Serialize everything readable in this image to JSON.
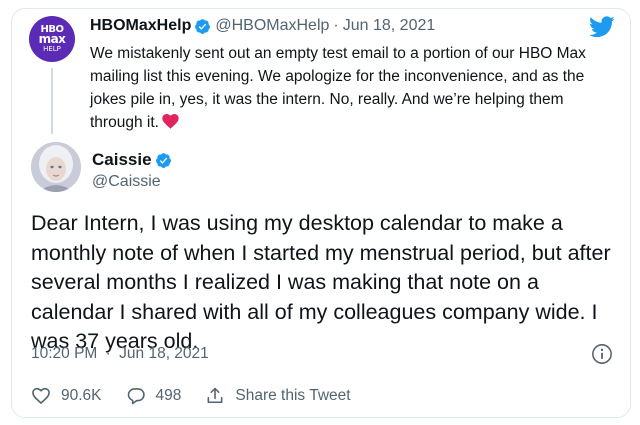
{
  "reply_to": {
    "avatar_lines": [
      "HBO",
      "max",
      "HELP"
    ],
    "display_name": "HBOMaxHelp",
    "handle": "@HBOMaxHelp",
    "date": "Jun 18, 2021",
    "text": "We mistakenly sent out an empty test email to a portion of our HBO Max mailing list this evening. We apologize for the inconvenience, and as the jokes pile in, yes, it was the intern. No, really. And we’re helping them through it.",
    "emoji_icon": "red-heart-icon",
    "verified_icon": "verified-badge-icon"
  },
  "brand_icon": "twitter-bird-icon",
  "tweet": {
    "display_name": "Caissie",
    "handle": "@Caissie",
    "verified_icon": "verified-badge-icon",
    "text": "Dear Intern, I was using my desktop calendar to make a monthly note of when I started my menstrual period, but after several months I realized I was making that note on a calendar I shared with all of my colleagues company wide. I was 37 years old.",
    "time": "10:20 PM",
    "date": "Jun 18, 2021",
    "info_icon": "info-icon"
  },
  "actions": {
    "like_count": "90.6K",
    "reply_count": "498",
    "share_label": "Share this Tweet"
  },
  "colors": {
    "verified_blue": "#1d9bf0",
    "hbo_purple": "#5b2bb5",
    "heart_red": "#e0245e",
    "muted_text": "#536471"
  }
}
